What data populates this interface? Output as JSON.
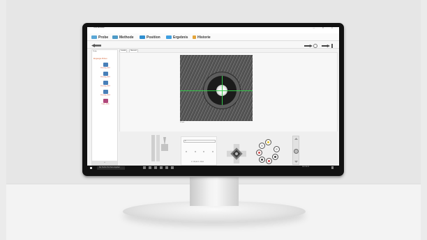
{
  "window": {
    "title": "Leica MicroMap",
    "controls": "— ☐ ✕"
  },
  "menu": [
    "Datei",
    "Ansicht",
    "Einstellungen",
    "Hilfe"
  ],
  "main_tabs": [
    {
      "label": "Probe",
      "color": "#5aa7d6"
    },
    {
      "label": "Methode",
      "color": "#4d9ac7"
    },
    {
      "label": "Position",
      "color": "#2f8fd0"
    },
    {
      "label": "Ergebnis",
      "color": "#3f9fe0"
    },
    {
      "label": "Historie",
      "color": "#e3a43a"
    }
  ],
  "sidebar": {
    "tab": "Probe",
    "header": "Eingelegte Proben",
    "items": [
      {
        "name": "Messung_0001",
        "color": "#4a7fb8"
      },
      {
        "name": "Messung_0002",
        "color": "#4a7fb8"
      },
      {
        "name": "Messung_0003",
        "color": "#4a7fb8"
      },
      {
        "name": "Messung_0004",
        "color": "#4a7fb8"
      },
      {
        "name": "Probe_0005",
        "color": "#b0467a"
      }
    ],
    "footer": "+"
  },
  "content_tabs": [
    "Livebild",
    "Übersicht"
  ],
  "camera": {
    "scale_label": "50 µm"
  },
  "position": {
    "field_value": "X:",
    "readout": "X: 124,00  Y: 43,00"
  },
  "turret_objectives": [
    {
      "color": "#e3c22c"
    },
    {
      "color": "#c4c4c4"
    },
    {
      "color": "#d24b4b"
    },
    {
      "color": "#3b3b3b"
    },
    {
      "color": "#d24b4b"
    },
    {
      "color": "#3b3b3b"
    },
    {
      "color": "#c4c4c4"
    }
  ],
  "taskbar": {
    "search_placeholder": "Zur Suche Text hier eingeben",
    "tray_text": "DEU  08:15"
  }
}
